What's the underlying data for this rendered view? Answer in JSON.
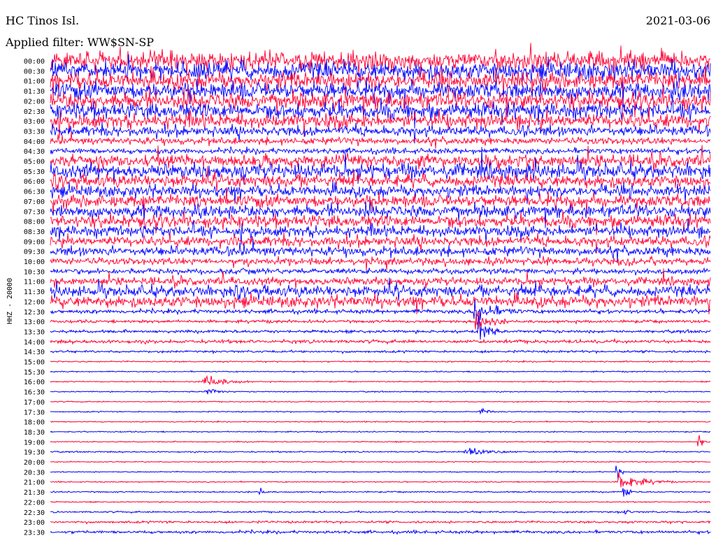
{
  "header": {
    "station": "HC Tinos Isl.",
    "date": "2021-03-06",
    "filter": "Applied filter: WW$SN-SP",
    "channel": "HHZ - 20000"
  },
  "colors": {
    "trace_a": "#0000ff",
    "trace_b": "#ff0033",
    "text": "#000000"
  },
  "chart_data": {
    "type": "line",
    "title": "HC Tinos Isl.",
    "subtitle": "2021-03-06",
    "ylabel": "HHZ - 20000",
    "row_labels": [
      "00:00",
      "00:30",
      "01:00",
      "01:30",
      "02:00",
      "02:30",
      "03:00",
      "03:30",
      "04:00",
      "04:30",
      "05:00",
      "05:30",
      "06:00",
      "06:30",
      "07:00",
      "07:30",
      "08:00",
      "08:30",
      "09:00",
      "09:30",
      "10:00",
      "10:30",
      "11:00",
      "11:30",
      "12:00",
      "12:30",
      "13:00",
      "13:30",
      "14:00",
      "14:30",
      "15:00",
      "15:30",
      "16:00",
      "16:30",
      "17:00",
      "17:30",
      "18:00",
      "18:30",
      "19:00",
      "19:30",
      "20:00",
      "20:30",
      "21:00",
      "21:30",
      "22:00",
      "22:30",
      "23:00",
      "23:30"
    ],
    "row_colors": [
      "trace_b",
      "trace_a",
      "trace_b",
      "trace_a",
      "trace_b",
      "trace_a",
      "trace_b",
      "trace_a",
      "trace_b",
      "trace_a",
      "trace_b",
      "trace_a",
      "trace_b",
      "trace_a",
      "trace_b",
      "trace_a",
      "trace_b",
      "trace_a",
      "trace_b",
      "trace_a",
      "trace_b",
      "trace_a",
      "trace_b",
      "trace_a",
      "trace_b",
      "trace_a",
      "trace_b",
      "trace_a",
      "trace_b",
      "trace_a",
      "trace_b",
      "trace_a",
      "trace_b",
      "trace_a",
      "trace_b",
      "trace_a",
      "trace_b",
      "trace_a",
      "trace_b",
      "trace_a",
      "trace_b",
      "trace_a",
      "trace_b",
      "trace_a",
      "trace_b",
      "trace_a",
      "trace_b",
      "trace_a"
    ],
    "row_minutes": 30,
    "noise_level": [
      16,
      16,
      15,
      15,
      15,
      14,
      13,
      9,
      6,
      5,
      11,
      13,
      11,
      10,
      11,
      11,
      11,
      10,
      9,
      8,
      6,
      5,
      7,
      10,
      10,
      3.5,
      2.5,
      2.5,
      3,
      2,
      1.2,
      1,
      1,
      1,
      1,
      1,
      1,
      1,
      1,
      1.2,
      1,
      1,
      1,
      1.2,
      1,
      1.5,
      2,
      2.5
    ],
    "events": [
      {
        "row": 0,
        "minute": 14.5,
        "amplitude": 60,
        "duration_min": 0.2
      },
      {
        "row": 25,
        "minute": 19.2,
        "amplitude": 25,
        "duration_min": 2.2
      },
      {
        "row": 26,
        "minute": 19.3,
        "amplitude": 30,
        "duration_min": 1.5
      },
      {
        "row": 27,
        "minute": 19.4,
        "amplitude": 40,
        "duration_min": 1
      },
      {
        "row": 30,
        "minute": 0.3,
        "amplitude": 6,
        "duration_min": 0.3
      },
      {
        "row": 32,
        "minute": 6.9,
        "amplitude": 18,
        "duration_min": 2.2
      },
      {
        "row": 33,
        "minute": 7.0,
        "amplitude": 12,
        "duration_min": 1.2
      },
      {
        "row": 35,
        "minute": 19.5,
        "amplitude": 6,
        "duration_min": 1.4
      },
      {
        "row": 38,
        "minute": 29.4,
        "amplitude": 18,
        "duration_min": 0.6
      },
      {
        "row": 39,
        "minute": 18.8,
        "amplitude": 14,
        "duration_min": 2.4
      },
      {
        "row": 41,
        "minute": 25.7,
        "amplitude": 40,
        "duration_min": 0.4
      },
      {
        "row": 42,
        "minute": 25.8,
        "amplitude": 20,
        "duration_min": 2.5
      },
      {
        "row": 43,
        "minute": 9.5,
        "amplitude": 10,
        "duration_min": 0.5
      },
      {
        "row": 43,
        "minute": 26,
        "amplitude": 22,
        "duration_min": 0.6
      },
      {
        "row": 45,
        "minute": 26,
        "amplitude": 15,
        "duration_min": 0.5
      }
    ]
  }
}
